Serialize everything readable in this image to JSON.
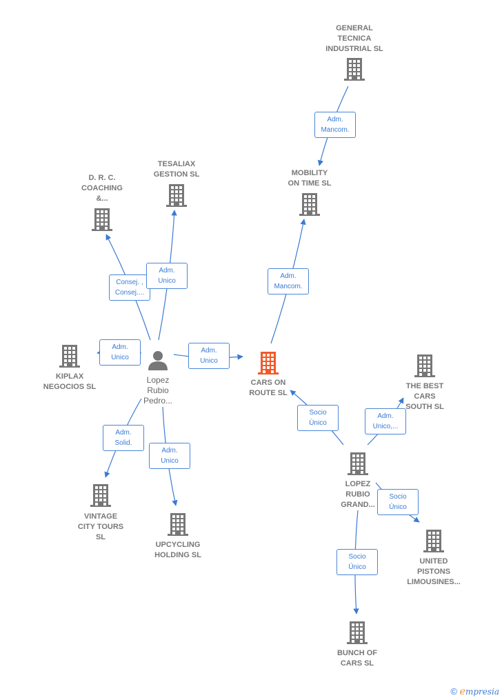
{
  "colors": {
    "node": "#777777",
    "focus": "#f05a28",
    "edge": "#3a7ad5"
  },
  "nodes": [
    {
      "id": "general",
      "label": "GENERAL\nTECNICA\nINDUSTRIAL SL",
      "icon": "building-icon"
    },
    {
      "id": "mobility",
      "label": "MOBILITY\nON TIME  SL",
      "icon": "building-icon"
    },
    {
      "id": "tesaliax",
      "label": "TESALIAX\nGESTION  SL",
      "icon": "building-icon"
    },
    {
      "id": "drc",
      "label": "D.  R. C.\nCOACHING\n&...",
      "icon": "building-icon"
    },
    {
      "id": "kiplax",
      "label": "KIPLAX\nNEGOCIOS  SL",
      "icon": "building-icon"
    },
    {
      "id": "person",
      "label": "Lopez\nRubio\nPedro...",
      "icon": "person-icon"
    },
    {
      "id": "cars",
      "label": "CARS ON\nROUTE  SL",
      "icon": "building-icon",
      "focus": true
    },
    {
      "id": "bestcars",
      "label": "THE BEST\nCARS\nSOUTH  SL",
      "icon": "building-icon"
    },
    {
      "id": "lopezgrand",
      "label": "LOPEZ\nRUBIO\nGRAND...",
      "icon": "building-icon"
    },
    {
      "id": "vintage",
      "label": "VINTAGE\nCITY TOURS\nSL",
      "icon": "building-icon"
    },
    {
      "id": "upcycling",
      "label": "UPCYCLING\nHOLDING  SL",
      "icon": "building-icon"
    },
    {
      "id": "united",
      "label": "UNITED\nPISTONS\nLIMOUSINES...",
      "icon": "building-icon"
    },
    {
      "id": "bunch",
      "label": "BUNCH OF\nCARS  SL",
      "icon": "building-icon"
    }
  ],
  "edges": [
    {
      "from": "general",
      "to": "mobility",
      "label": "Adm.\nMancom."
    },
    {
      "from": "cars",
      "to": "mobility",
      "label": "Adm.\nMancom."
    },
    {
      "from": "person",
      "to": "drc",
      "label": "Consej. ,\nConsej...."
    },
    {
      "from": "person",
      "to": "tesaliax",
      "label": "Adm.\nUnico"
    },
    {
      "from": "person",
      "to": "kiplax",
      "label": "Adm.\nUnico"
    },
    {
      "from": "person",
      "to": "cars",
      "label": "Adm.\nUnico"
    },
    {
      "from": "person",
      "to": "vintage",
      "label": "Adm.\nSolid."
    },
    {
      "from": "person",
      "to": "upcycling",
      "label": "Adm.\nUnico"
    },
    {
      "from": "lopezgrand",
      "to": "cars",
      "label": "Socio\nÚnico"
    },
    {
      "from": "lopezgrand",
      "to": "bestcars",
      "label": "Adm.\nUnico,..."
    },
    {
      "from": "lopezgrand",
      "to": "united",
      "label": "Socio\nÚnico"
    },
    {
      "from": "lopezgrand",
      "to": "bunch",
      "label": "Socio\nÚnico"
    }
  ],
  "footer": {
    "copyright": "©",
    "brand_initial": "e",
    "brand_rest": "mpresia"
  }
}
